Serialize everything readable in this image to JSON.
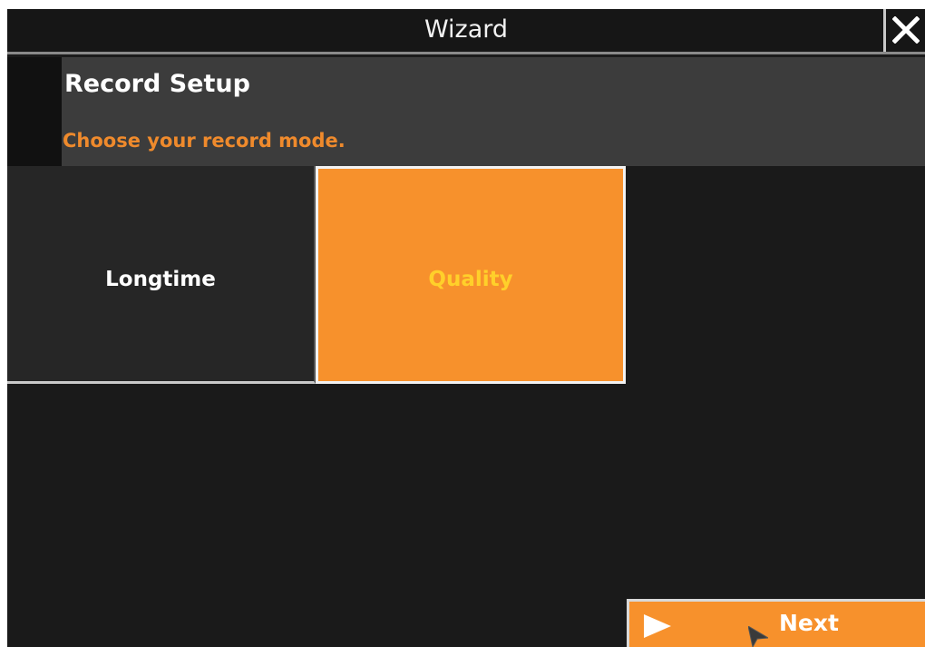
{
  "window": {
    "title": "Wizard"
  },
  "header": {
    "section_title": "Record Setup",
    "hint": "Choose your record mode."
  },
  "modes": [
    {
      "label": "Longtime",
      "selected": false
    },
    {
      "label": "Quality",
      "selected": true
    }
  ],
  "footer": {
    "next_label": "Next"
  },
  "icons": {
    "close": "close-icon",
    "next": "play-icon",
    "cursor": "mouse-pointer-icon"
  },
  "colors": {
    "background": "#1a1a1a",
    "accent": "#f7912c",
    "hint_text": "#ef8a2c",
    "selected_label": "#ffd02a",
    "header_panel": "#3c3c3c"
  }
}
